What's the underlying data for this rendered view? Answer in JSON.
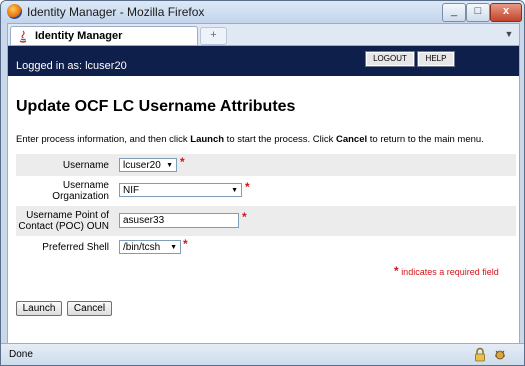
{
  "window": {
    "title": "Identity Manager - Mozilla Firefox",
    "minimize": "_",
    "maximize": "□",
    "close": "x"
  },
  "tabs": {
    "active_label": "Identity Manager",
    "new_tab": "+",
    "tab_list": "▼"
  },
  "header": {
    "login_text": "Logged in as: lcuser20",
    "logout_label": "LOGOUT",
    "help_label": "HELP",
    "bg_color": "#0f1f4b"
  },
  "page": {
    "title": "Update OCF LC Username Attributes",
    "instr_1": "Enter process information, and then click ",
    "instr_launch": "Launch",
    "instr_2": " to start the process. Click ",
    "instr_cancel": "Cancel",
    "instr_3": " to return to the main menu."
  },
  "form": {
    "username_label": "Username",
    "username_value": "lcuser20",
    "org_label_1": "Username",
    "org_label_2": "Organization",
    "org_value": "NIF",
    "poc_label_1": "Username Point of",
    "poc_label_2": "Contact (POC) OUN",
    "poc_value": "asuser33",
    "shell_label": "Preferred Shell",
    "shell_value": "/bin/tcsh",
    "required_star": "*",
    "required_legend": "indicates a required field"
  },
  "buttons": {
    "launch": "Launch",
    "cancel": "Cancel"
  },
  "status": {
    "text": "Done"
  }
}
